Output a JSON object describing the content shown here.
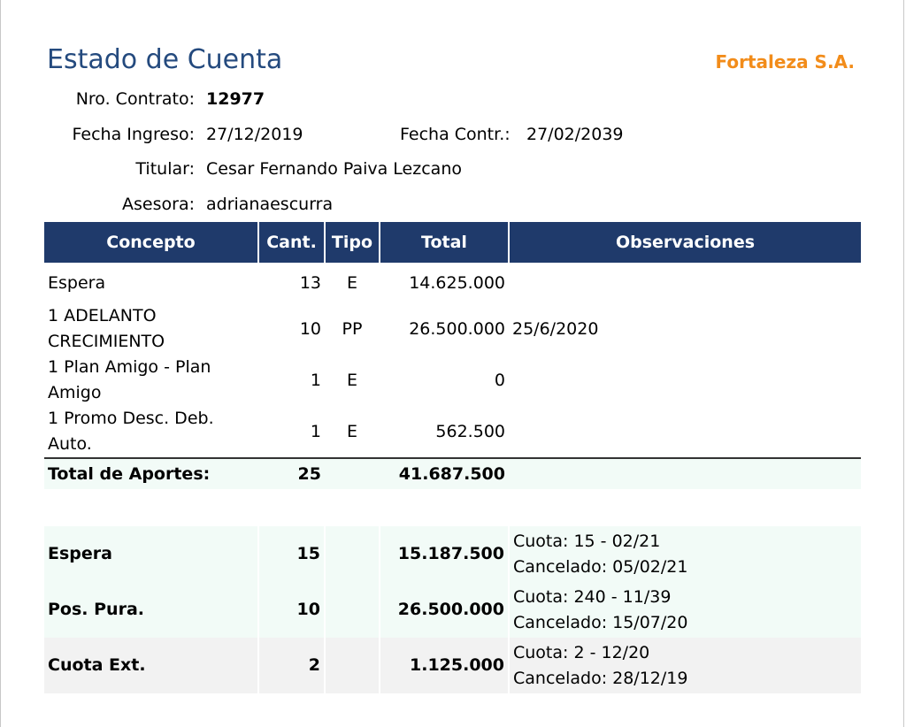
{
  "header": {
    "title": "Estado de Cuenta",
    "company": "Fortaleza S.A."
  },
  "info": {
    "contrato_label": "Nro. Contrato:",
    "contrato_value": "12977",
    "ingreso_label": "Fecha Ingreso:",
    "ingreso_value": "27/12/2019",
    "contr_label": "Fecha Contr.:",
    "contr_value": "27/02/2039",
    "titular_label": "Titular:",
    "titular_value": "Cesar Fernando Paiva Lezcano",
    "asesora_label": "Asesora:",
    "asesora_value": "adrianaescurra"
  },
  "table": {
    "headers": [
      "Concepto",
      "Cant.",
      "Tipo",
      "Total",
      "Observaciones"
    ],
    "items": [
      {
        "concepto": "Espera",
        "cant": "13",
        "tipo": "E",
        "total": "14.625.000",
        "obs": ""
      },
      {
        "concepto": "1 ADELANTO CRECIMIENTO",
        "cant": "10",
        "tipo": "PP",
        "total": "26.500.000",
        "obs": "25/6/2020"
      },
      {
        "concepto": "1 Plan Amigo - Plan Amigo",
        "cant": "1",
        "tipo": "E",
        "total": "0",
        "obs": ""
      },
      {
        "concepto": "1 Promo Desc. Deb. Auto.",
        "cant": "1",
        "tipo": "E",
        "total": "562.500",
        "obs": ""
      }
    ],
    "total": {
      "label": "Total de Aportes:",
      "cant": "25",
      "total": "41.687.500"
    },
    "summary": [
      {
        "concepto": "Espera",
        "cant": "15",
        "total": "15.187.500",
        "obs1": "Cuota: 15 - 02/21",
        "obs2": "Cancelado: 05/02/21"
      },
      {
        "concepto": "Pos. Pura.",
        "cant": "10",
        "total": "26.500.000",
        "obs1": "Cuota: 240 - 11/39",
        "obs2": "Cancelado: 15/07/20"
      },
      {
        "concepto": "Cuota Ext.",
        "cant": "2",
        "total": "1.125.000",
        "obs1": "Cuota: 2 - 12/20",
        "obs2": "Cancelado: 28/12/19"
      }
    ]
  }
}
